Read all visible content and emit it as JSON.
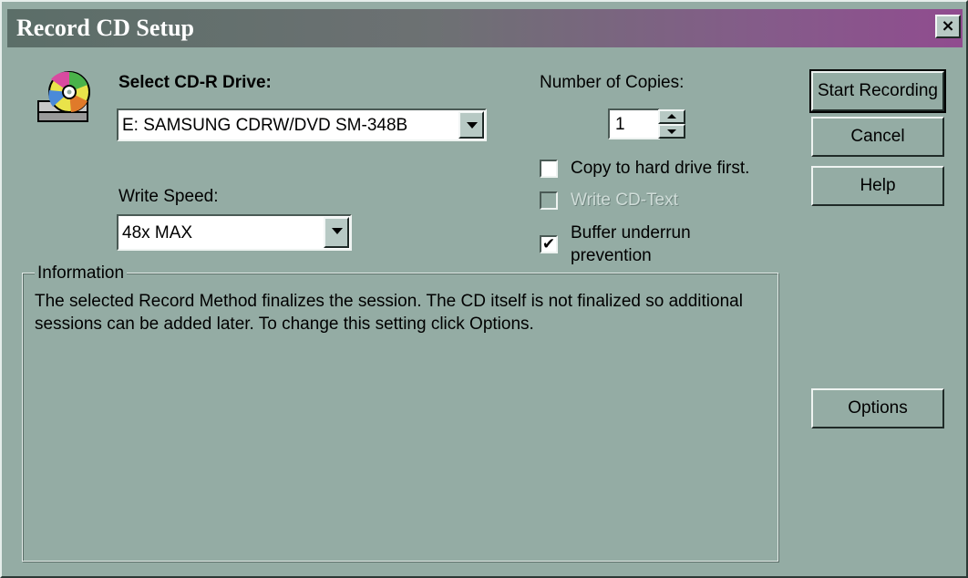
{
  "window": {
    "title": "Record CD Setup",
    "close_glyph": "×"
  },
  "drive": {
    "label": "Select CD-R Drive:",
    "selected": "E: SAMSUNG CDRW/DVD SM-348B"
  },
  "speed": {
    "label": "Write Speed:",
    "selected": "48x MAX"
  },
  "copies": {
    "label": "Number of Copies:",
    "value": "1"
  },
  "options": {
    "copy_to_hd": {
      "label": "Copy to hard drive first.",
      "checked": false,
      "enabled": true
    },
    "write_cd_text": {
      "label": "Write CD-Text",
      "checked": false,
      "enabled": false
    },
    "buffer_underrun": {
      "label_line1": "Buffer underrun",
      "label_line2": "prevention",
      "checked": true,
      "enabled": true,
      "check_glyph": "✔"
    }
  },
  "buttons": {
    "start_recording": "Start Recording",
    "cancel": "Cancel",
    "help": "Help",
    "options": "Options"
  },
  "information": {
    "legend": "Information",
    "text": "The selected Record Method finalizes the session. The CD itself is not finalized so additional sessions can be added later. To change this setting click Options."
  },
  "icons": {
    "drive_icon": "cd-drive-icon"
  },
  "colors": {
    "face": "#94aca4",
    "title_start": "#5b6e68",
    "title_end": "#904c8f"
  }
}
